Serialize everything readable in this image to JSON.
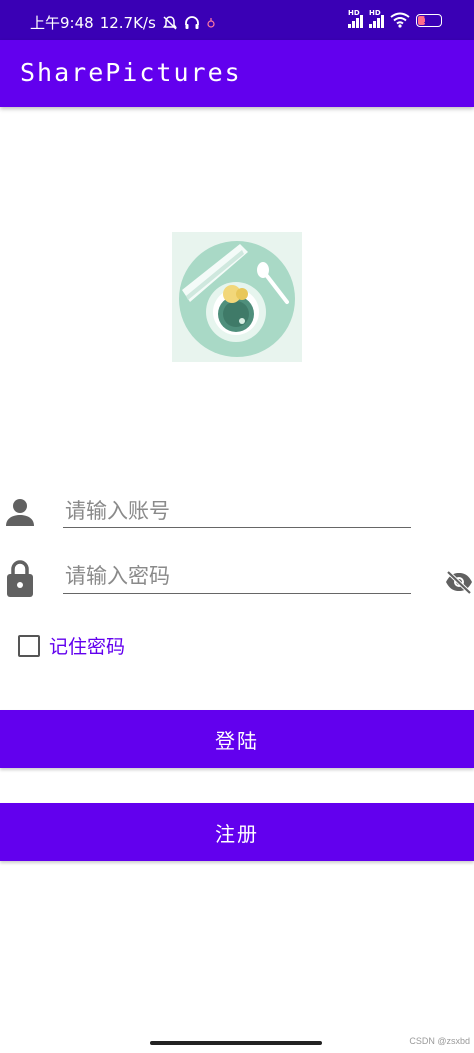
{
  "status_bar": {
    "time": "上午9:48",
    "speed": "12.7K/s",
    "battery": "16",
    "hd_label": "HD"
  },
  "app_bar": {
    "title": "SharePictures"
  },
  "login_form": {
    "account_placeholder": "请输入账号",
    "password_placeholder": "请输入密码",
    "remember_label": "记住密码",
    "remember_checked": false
  },
  "buttons": {
    "login_label": "登陆",
    "register_label": "注册"
  },
  "footer": {
    "watermark": "CSDN @zsxbd"
  },
  "colors": {
    "primary": "#6200ee",
    "status_bar": "#3a00b5",
    "background": "#ffffff",
    "icon_gray": "#616161"
  },
  "icons": [
    "person-icon",
    "lock-icon",
    "eye-off-icon",
    "bell-off-icon",
    "headset-icon",
    "wifi-icon",
    "battery-icon"
  ]
}
